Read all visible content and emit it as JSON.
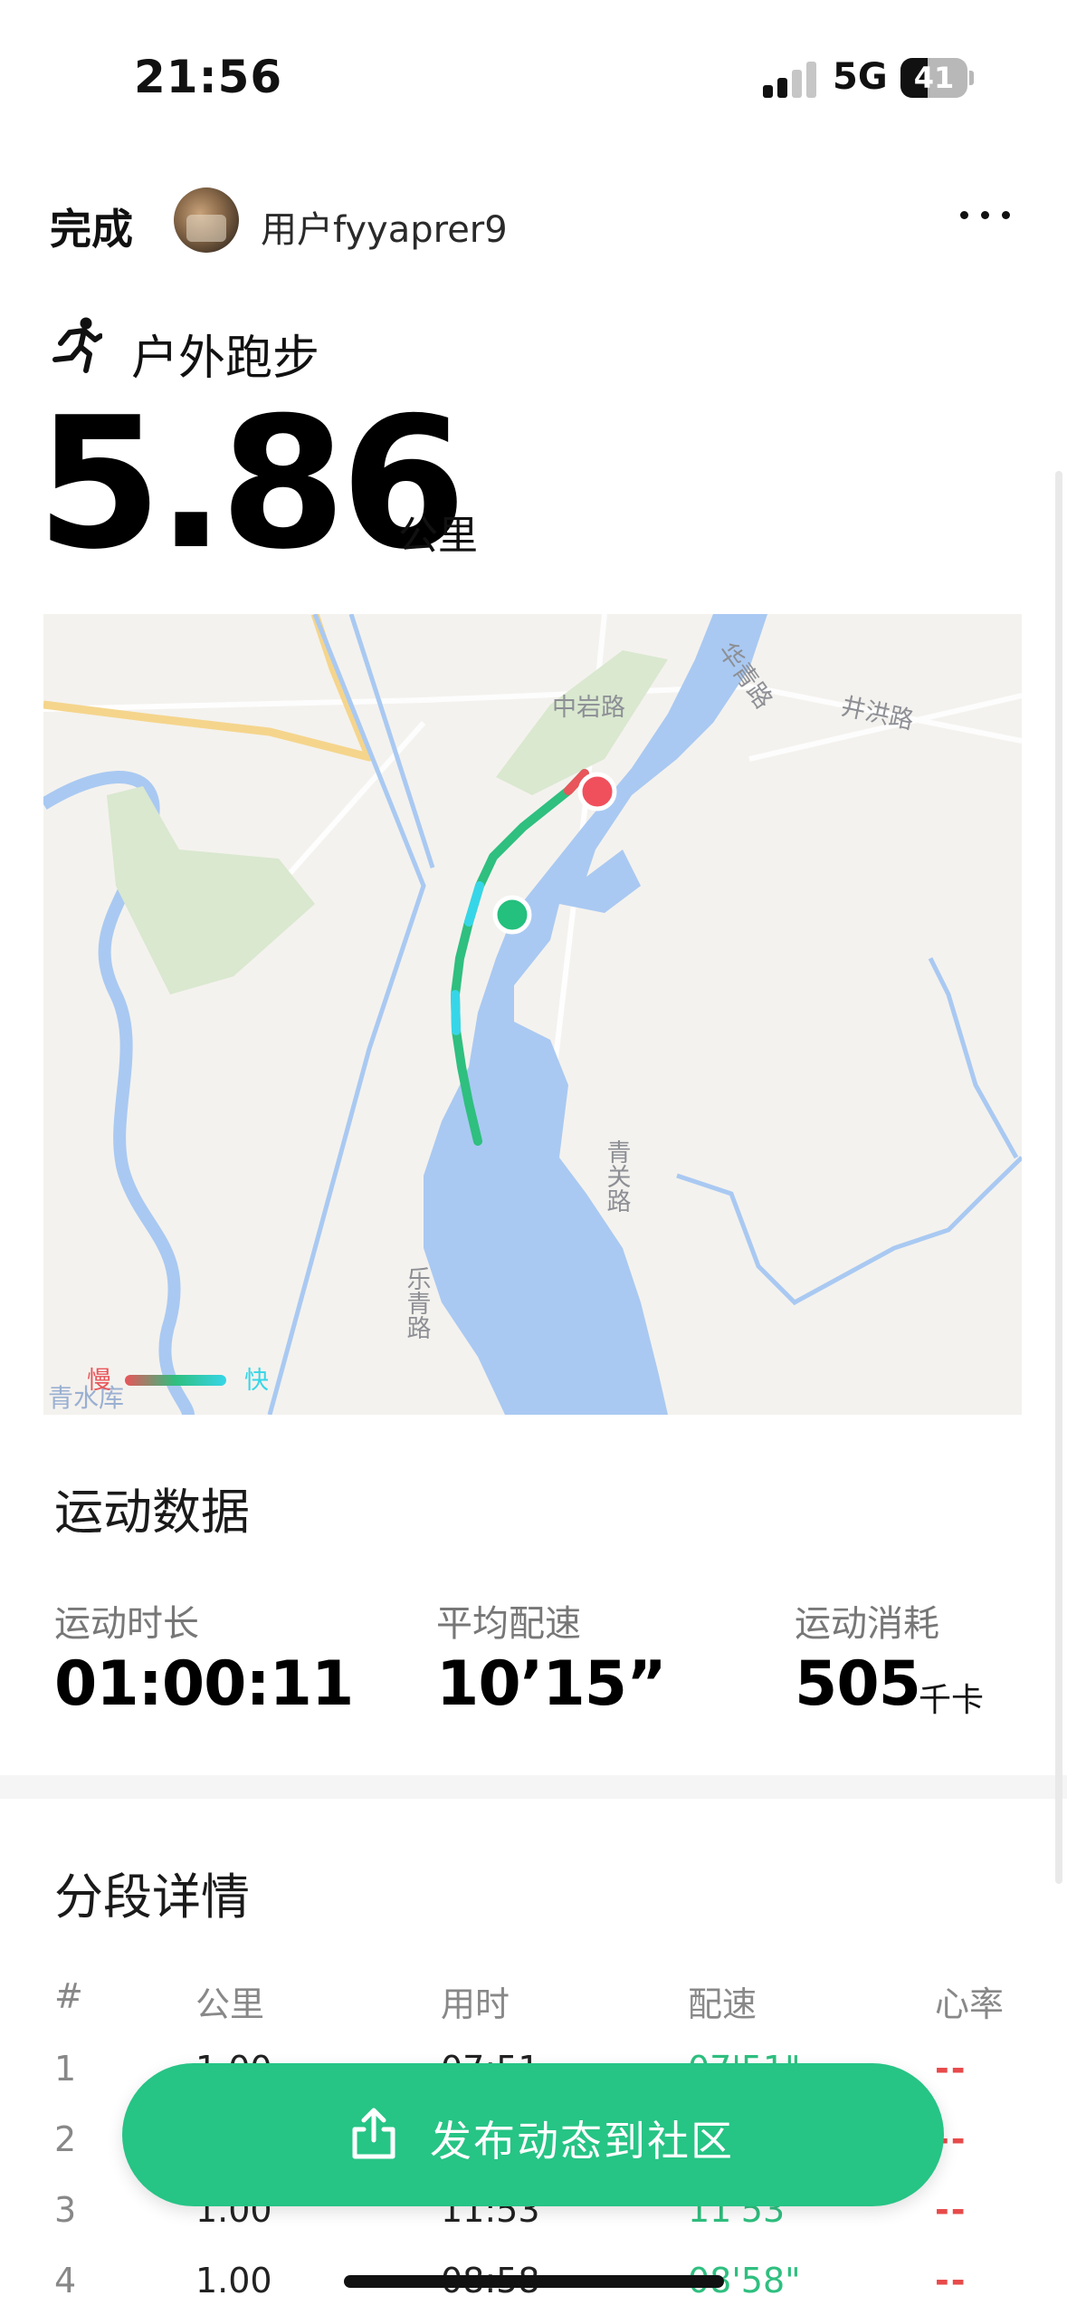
{
  "status_bar": {
    "time": "21:56",
    "network": "5G",
    "battery": "41",
    "battery_level": 0.41
  },
  "header": {
    "done_label": "完成",
    "username": "用户fyyaprer9"
  },
  "activity": {
    "type_label": "户外跑步",
    "distance": "5.86",
    "distance_unit": "公里"
  },
  "map": {
    "road_labels": [
      "中岩路",
      "井洪路",
      "华青路",
      "青关路",
      "乐青路"
    ],
    "reservoir_label": "青水库",
    "legend_slow": "慢",
    "legend_fast": "快",
    "colors": {
      "water": "#a9c9f2",
      "park": "#d9e8cf",
      "route_fast": "#36d6e8",
      "route_mid": "#2fbf7f",
      "route_slow": "#e8555a",
      "start": "#24c07d",
      "end": "#f0505c"
    }
  },
  "stats": {
    "title": "运动数据",
    "duration_label": "运动时长",
    "duration_value": "01:00:11",
    "pace_label": "平均配速",
    "pace_value": "10’15”",
    "calories_label": "运动消耗",
    "calories_value": "505",
    "calories_unit": "千卡"
  },
  "splits": {
    "title": "分段详情",
    "columns": [
      "#",
      "公里",
      "用时",
      "配速",
      "心率"
    ],
    "rows": [
      {
        "idx": "1",
        "km": "1.00",
        "time": "07:51",
        "pace": "07'51\"",
        "hr": "--"
      },
      {
        "idx": "2",
        "km": "",
        "time": "",
        "pace": "",
        "hr": "--"
      },
      {
        "idx": "3",
        "km": "1.00",
        "time": "11:53",
        "pace": "11'53\"",
        "hr": "--"
      },
      {
        "idx": "4",
        "km": "1.00",
        "time": "08:58",
        "pace": "08'58\"",
        "hr": "--"
      }
    ]
  },
  "publish_button": {
    "label": "发布动态到社区"
  }
}
